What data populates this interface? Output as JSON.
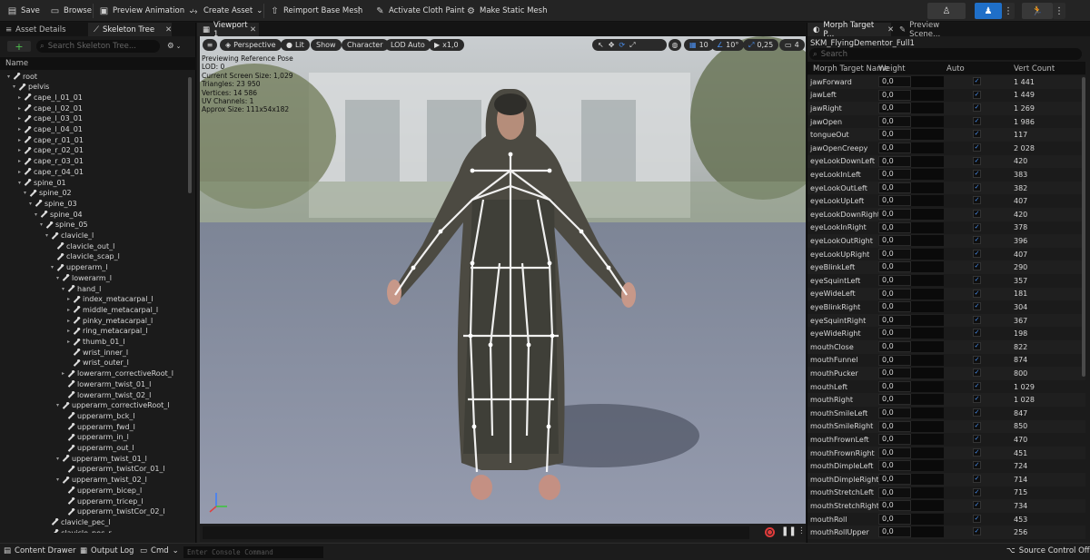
{
  "toolbar": {
    "save": "Save",
    "browse": "Browse",
    "preview_animation": "Preview Animation",
    "create_asset": "Create Asset",
    "reimport": "Reimport Base Mesh",
    "activate_cloth": "Activate Cloth Paint",
    "make_static": "Make Static Mesh"
  },
  "left_panel": {
    "tab_asset_details": "Asset Details",
    "tab_skeleton_tree": "Skeleton Tree",
    "search_placeholder": "Search Skeleton Tree...",
    "column_name": "Name",
    "bones": [
      {
        "name": "root",
        "depth": 0,
        "arrow": "▾"
      },
      {
        "name": "pelvis",
        "depth": 1,
        "arrow": "▾"
      },
      {
        "name": "cape_l_01_01",
        "depth": 2,
        "arrow": "▸"
      },
      {
        "name": "cape_l_02_01",
        "depth": 2,
        "arrow": "▸"
      },
      {
        "name": "cape_l_03_01",
        "depth": 2,
        "arrow": "▸"
      },
      {
        "name": "cape_l_04_01",
        "depth": 2,
        "arrow": "▸"
      },
      {
        "name": "cape_r_01_01",
        "depth": 2,
        "arrow": "▸"
      },
      {
        "name": "cape_r_02_01",
        "depth": 2,
        "arrow": "▸"
      },
      {
        "name": "cape_r_03_01",
        "depth": 2,
        "arrow": "▸"
      },
      {
        "name": "cape_r_04_01",
        "depth": 2,
        "arrow": "▸"
      },
      {
        "name": "spine_01",
        "depth": 2,
        "arrow": "▾"
      },
      {
        "name": "spine_02",
        "depth": 3,
        "arrow": "▾"
      },
      {
        "name": "spine_03",
        "depth": 4,
        "arrow": "▾"
      },
      {
        "name": "spine_04",
        "depth": 5,
        "arrow": "▾"
      },
      {
        "name": "spine_05",
        "depth": 6,
        "arrow": "▾"
      },
      {
        "name": "clavicle_l",
        "depth": 7,
        "arrow": "▾"
      },
      {
        "name": "clavicle_out_l",
        "depth": 8,
        "arrow": ""
      },
      {
        "name": "clavicle_scap_l",
        "depth": 8,
        "arrow": ""
      },
      {
        "name": "upperarm_l",
        "depth": 8,
        "arrow": "▾"
      },
      {
        "name": "lowerarm_l",
        "depth": 9,
        "arrow": "▾"
      },
      {
        "name": "hand_l",
        "depth": 10,
        "arrow": "▾"
      },
      {
        "name": "index_metacarpal_l",
        "depth": 11,
        "arrow": "▸"
      },
      {
        "name": "middle_metacarpal_l",
        "depth": 11,
        "arrow": "▸"
      },
      {
        "name": "pinky_metacarpal_l",
        "depth": 11,
        "arrow": "▸"
      },
      {
        "name": "ring_metacarpal_l",
        "depth": 11,
        "arrow": "▸"
      },
      {
        "name": "thumb_01_l",
        "depth": 11,
        "arrow": "▸"
      },
      {
        "name": "wrist_inner_l",
        "depth": 11,
        "arrow": ""
      },
      {
        "name": "wrist_outer_l",
        "depth": 11,
        "arrow": ""
      },
      {
        "name": "lowerarm_correctiveRoot_l",
        "depth": 10,
        "arrow": "▸"
      },
      {
        "name": "lowerarm_twist_01_l",
        "depth": 10,
        "arrow": ""
      },
      {
        "name": "lowerarm_twist_02_l",
        "depth": 10,
        "arrow": ""
      },
      {
        "name": "upperarm_correctiveRoot_l",
        "depth": 9,
        "arrow": "▾"
      },
      {
        "name": "upperarm_bck_l",
        "depth": 10,
        "arrow": ""
      },
      {
        "name": "upperarm_fwd_l",
        "depth": 10,
        "arrow": ""
      },
      {
        "name": "upperarm_in_l",
        "depth": 10,
        "arrow": ""
      },
      {
        "name": "upperarm_out_l",
        "depth": 10,
        "arrow": ""
      },
      {
        "name": "upperarm_twist_01_l",
        "depth": 9,
        "arrow": "▾"
      },
      {
        "name": "upperarm_twistCor_01_l",
        "depth": 10,
        "arrow": ""
      },
      {
        "name": "upperarm_twist_02_l",
        "depth": 9,
        "arrow": "▾"
      },
      {
        "name": "upperarm_bicep_l",
        "depth": 10,
        "arrow": ""
      },
      {
        "name": "upperarm_tricep_l",
        "depth": 10,
        "arrow": ""
      },
      {
        "name": "upperarm_twistCor_02_l",
        "depth": 10,
        "arrow": ""
      },
      {
        "name": "clavicle_pec_l",
        "depth": 7,
        "arrow": ""
      },
      {
        "name": "clavicle_pec_r",
        "depth": 7,
        "arrow": ""
      }
    ]
  },
  "viewport": {
    "tab": "Viewport 1",
    "perspective": "Perspective",
    "lit": "Lit",
    "show": "Show",
    "character": "Character",
    "lod": "LOD Auto",
    "play_speed": "x1,0",
    "grid_snap": "10",
    "rot_snap": "10°",
    "scale_snap": "0,25",
    "cam_speed": "4",
    "stats": [
      "Previewing Reference Pose",
      "LOD: 0",
      "Current Screen Size: 1,029",
      "Triangles: 23 950",
      "Vertices: 14 586",
      "UV Channels: 1",
      "Approx Size: 111x54x182"
    ]
  },
  "right_panel": {
    "tab_morph": "Morph Target P...",
    "tab_preview": "Preview Scene...",
    "asset_name": "SKM_FlyingDementor_Full1",
    "search_placeholder": "Search",
    "columns": [
      "Morph Target Name",
      "Weight",
      "Auto",
      "Vert Count"
    ],
    "morphs": [
      {
        "name": "jawForward",
        "weight": "0,0",
        "verts": "1 441"
      },
      {
        "name": "jawLeft",
        "weight": "0,0",
        "verts": "1 449"
      },
      {
        "name": "jawRight",
        "weight": "0,0",
        "verts": "1 269"
      },
      {
        "name": "jawOpen",
        "weight": "0,0",
        "verts": "1 986"
      },
      {
        "name": "tongueOut",
        "weight": "0,0",
        "verts": "117"
      },
      {
        "name": "jawOpenCreepy",
        "weight": "0,0",
        "verts": "2 028"
      },
      {
        "name": "eyeLookDownLeft",
        "weight": "0,0",
        "verts": "420"
      },
      {
        "name": "eyeLookInLeft",
        "weight": "0,0",
        "verts": "383"
      },
      {
        "name": "eyeLookOutLeft",
        "weight": "0,0",
        "verts": "382"
      },
      {
        "name": "eyeLookUpLeft",
        "weight": "0,0",
        "verts": "407"
      },
      {
        "name": "eyeLookDownRight",
        "weight": "0,0",
        "verts": "420"
      },
      {
        "name": "eyeLookInRight",
        "weight": "0,0",
        "verts": "378"
      },
      {
        "name": "eyeLookOutRight",
        "weight": "0,0",
        "verts": "396"
      },
      {
        "name": "eyeLookUpRight",
        "weight": "0,0",
        "verts": "407"
      },
      {
        "name": "eyeBlinkLeft",
        "weight": "0,0",
        "verts": "290"
      },
      {
        "name": "eyeSquintLeft",
        "weight": "0,0",
        "verts": "357"
      },
      {
        "name": "eyeWideLeft",
        "weight": "0,0",
        "verts": "181"
      },
      {
        "name": "eyeBlinkRight",
        "weight": "0,0",
        "verts": "304"
      },
      {
        "name": "eyeSquintRight",
        "weight": "0,0",
        "verts": "367"
      },
      {
        "name": "eyeWideRight",
        "weight": "0,0",
        "verts": "198"
      },
      {
        "name": "mouthClose",
        "weight": "0,0",
        "verts": "822"
      },
      {
        "name": "mouthFunnel",
        "weight": "0,0",
        "verts": "874"
      },
      {
        "name": "mouthPucker",
        "weight": "0,0",
        "verts": "800"
      },
      {
        "name": "mouthLeft",
        "weight": "0,0",
        "verts": "1 029"
      },
      {
        "name": "mouthRight",
        "weight": "0,0",
        "verts": "1 028"
      },
      {
        "name": "mouthSmileLeft",
        "weight": "0,0",
        "verts": "847"
      },
      {
        "name": "mouthSmileRight",
        "weight": "0,0",
        "verts": "850"
      },
      {
        "name": "mouthFrownLeft",
        "weight": "0,0",
        "verts": "470"
      },
      {
        "name": "mouthFrownRight",
        "weight": "0,0",
        "verts": "451"
      },
      {
        "name": "mouthDimpleLeft",
        "weight": "0,0",
        "verts": "724"
      },
      {
        "name": "mouthDimpleRight",
        "weight": "0,0",
        "verts": "714"
      },
      {
        "name": "mouthStretchLeft",
        "weight": "0,0",
        "verts": "715"
      },
      {
        "name": "mouthStretchRight",
        "weight": "0,0",
        "verts": "734"
      },
      {
        "name": "mouthRoll",
        "weight": "0,0",
        "verts": "453"
      },
      {
        "name": "mouthRollUpper",
        "weight": "0,0",
        "verts": "256"
      }
    ]
  },
  "bottom": {
    "content_drawer": "Content Drawer",
    "output_log": "Output Log",
    "cmd": "Cmd",
    "console_placeholder": "Enter Console Command",
    "source_control": "Source Control Off"
  },
  "colors": {
    "accent": "#2a7fd4",
    "selected_mode": "#1f6fc8",
    "bg": "#151515"
  }
}
